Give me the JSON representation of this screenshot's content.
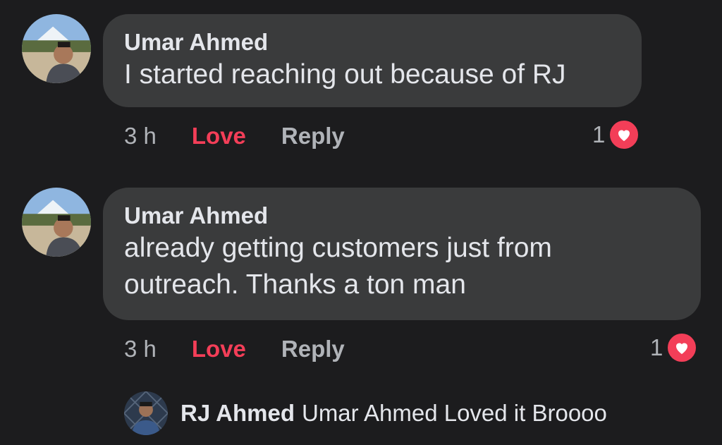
{
  "comments": [
    {
      "author": "Umar Ahmed",
      "text_lines": [
        "I started reaching out because of RJ"
      ],
      "time": "3 h",
      "love_label": "Love",
      "reply_label": "Reply",
      "reaction_count": "1",
      "reaction_icon": "heart-icon"
    },
    {
      "author": "Umar Ahmed",
      "text_lines": [
        "already getting customers just from",
        "outreach. Thanks a ton man"
      ],
      "time": "3 h",
      "love_label": "Love",
      "reply_label": "Reply",
      "reaction_count": "1",
      "reaction_icon": "heart-icon"
    }
  ],
  "reply_preview": {
    "author": "RJ Ahmed",
    "text": "Umar Ahmed Loved it Broooo"
  },
  "colors": {
    "background": "#1c1c1e",
    "bubble": "#3a3b3c",
    "love": "#f33e58",
    "muted": "#b0b3b8",
    "text": "#e4e6eb"
  }
}
